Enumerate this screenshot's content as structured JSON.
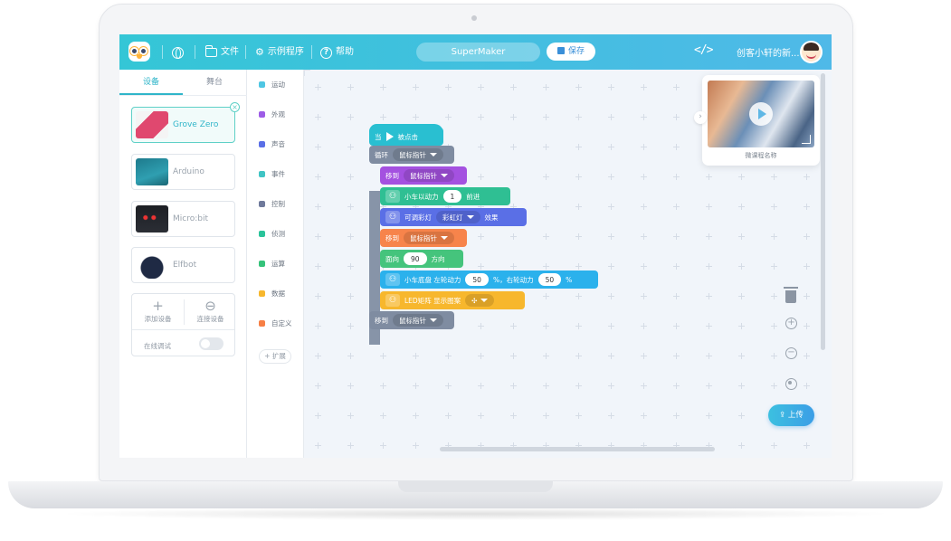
{
  "topbar": {
    "files": "文件",
    "examples": "示例程序",
    "help": "帮助",
    "project_name": "SuperMaker",
    "save": "保存",
    "code_toggle": "</>",
    "user": "创客小轩的新... ▾"
  },
  "device_panel": {
    "tabs": [
      "设备",
      "舞台"
    ],
    "devices": [
      {
        "name": "Grove Zero",
        "selected": true
      },
      {
        "name": "Arduino",
        "selected": false
      },
      {
        "name": "Micro:bit",
        "selected": false
      },
      {
        "name": "Elfbot",
        "selected": false
      }
    ],
    "add_device": "添加设备",
    "connect_device": "连接设备",
    "online_debug": "在线调试"
  },
  "categories": [
    {
      "label": "运动",
      "color": "#4fc6e3"
    },
    {
      "label": "外观",
      "color": "#9d5ce6"
    },
    {
      "label": "声音",
      "color": "#5a6fe6"
    },
    {
      "label": "事件",
      "color": "#40c4c4"
    },
    {
      "label": "控制",
      "color": "#6f7a9b"
    },
    {
      "label": "侦测",
      "color": "#2ac39a"
    },
    {
      "label": "运算",
      "color": "#35c27a"
    },
    {
      "label": "数据",
      "color": "#f7b72d"
    },
    {
      "label": "自定义",
      "color": "#f77f45"
    }
  ],
  "extension_label": "+ 扩展",
  "blocks": {
    "when": "当",
    "clicked": "被点击",
    "forever": "循环",
    "mouse_pointer": "鼠标指针",
    "move_to": "移到",
    "car_power": "小车以动力",
    "car_power_value": "1",
    "forward": "前进",
    "rgb_light": "可调彩灯",
    "rainbow": "彩虹灯",
    "effect": "效果",
    "face": "面向",
    "face_value": "90",
    "direction": "方向",
    "chassis": "小车底盘 左轮动力",
    "left_value": "50",
    "right_label": "%，右轮动力",
    "right_value": "50",
    "percent": "%",
    "led_matrix": "LED矩阵 显示图案"
  },
  "video": {
    "caption": "微课程名称"
  },
  "upload": "上传"
}
